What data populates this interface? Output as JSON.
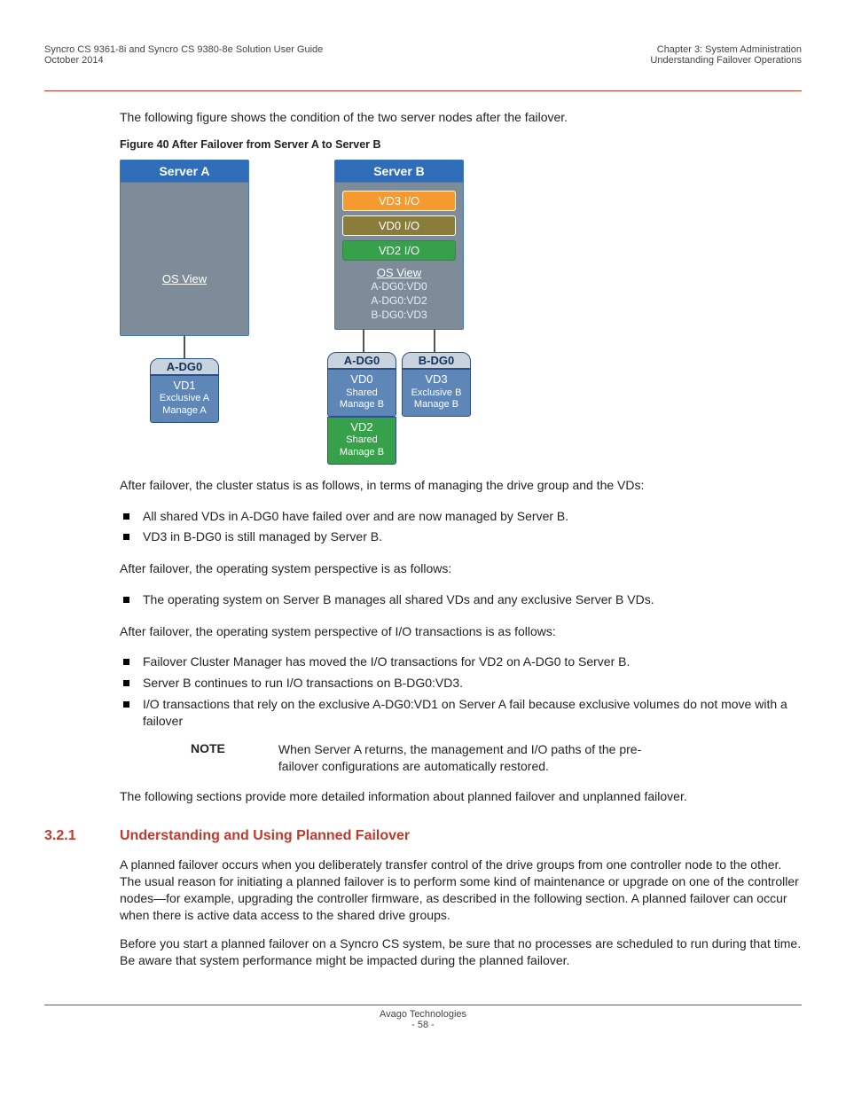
{
  "header": {
    "left1": "Syncro CS 9361-8i and Syncro CS 9380-8e Solution User Guide",
    "left2": "October 2014",
    "right1": "Chapter 3: System Administration",
    "right2": "Understanding Failover Operations"
  },
  "intro_fig": "The following figure shows the condition of the two server nodes after the failover.",
  "fig_caption": "Figure 40  After Failover from Server A to Server B",
  "fig": {
    "panelA": {
      "title": "Server A",
      "osview": "OS View"
    },
    "panelB": {
      "title": "Server B",
      "rows": {
        "r1": "VD3 I/O",
        "r2": "VD0 I/O",
        "r3": "VD2 I/O"
      },
      "osview": "OS View",
      "oslist": {
        "l1": "A-DG0:VD0",
        "l2": "A-DG0:VD2",
        "l3": "B-DG0:VD3"
      }
    },
    "dgA": {
      "tab": "A-DG0",
      "vd": "VD1",
      "l1": "Exclusive A",
      "l2": "Manage A"
    },
    "dgB1": {
      "tab": "A-DG0",
      "vd": "VD0",
      "l1": "Shared",
      "l2": "Manage B",
      "vd2": "VD2",
      "l21": "Shared",
      "l22": "Manage B"
    },
    "dgB2": {
      "tab": "B-DG0",
      "vd": "VD3",
      "l1": "Exclusive B",
      "l2": "Manage B"
    }
  },
  "p_after1": "After failover, the cluster status is as follows, in terms of managing the drive group and the VDs:",
  "list1": {
    "i1": "All shared VDs in A-DG0 have failed over and are now managed by Server B.",
    "i2": "VD3 in B-DG0 is still managed by Server B."
  },
  "p_after2": "After failover, the operating system perspective is as follows:",
  "list2": {
    "i1": "The operating system on Server B manages all shared VDs and any exclusive Server B VDs."
  },
  "p_after3": "After failover, the operating system perspective of I/O transactions is as follows:",
  "list3": {
    "i1": "Failover Cluster Manager has moved the I/O transactions for VD2 on A-DG0 to Server B.",
    "i2": "Server B continues to run I/O transactions on B-DG0:VD3.",
    "i3": "I/O transactions that rely on the exclusive A-DG0:VD1 on Server A fail because exclusive volumes do not move with a failover"
  },
  "note": {
    "label": "NOTE",
    "text": "When Server A returns, the management and I/O paths of the pre-failover configurations are automatically restored."
  },
  "p_outro": "The following sections provide more detailed information about planned failover and unplanned failover.",
  "section": {
    "num": "3.2.1",
    "title": "Understanding and Using Planned Failover"
  },
  "sec_p1": "A planned failover occurs when you deliberately transfer control of the drive groups from one controller node to the other. The usual reason for initiating a planned failover is to perform some kind of maintenance or upgrade on one of the controller nodes—for example, upgrading the controller firmware, as described in the following section. A planned failover can occur when there is active data access to the shared drive groups.",
  "sec_p2": "Before you start a planned failover on a Syncro CS system, be sure that no processes are scheduled to run during that time. Be aware that system performance might be impacted during the planned failover.",
  "footer": {
    "company": "Avago Technologies",
    "page": "- 58 -"
  }
}
